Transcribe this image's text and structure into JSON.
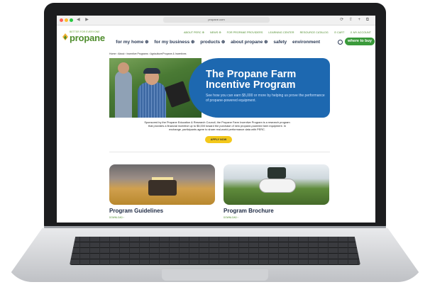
{
  "browser": {
    "url": "propane.com",
    "nav_glyphs": "◀ ▶",
    "right_glyphs": "⟳ ⇧ + ⧉",
    "dot_colors": [
      "#ff5f57",
      "#febc2e",
      "#28c840"
    ]
  },
  "site": {
    "logo_tagline": "BETTER FOR EVERYONE",
    "logo_name": "propane",
    "utility_links": [
      "ABOUT PERC ⊕",
      "NEWS ⊕",
      "FOR PROPANE PROVIDERS",
      "LEARNING CENTER",
      "RESOURCE CATALOG",
      "⊙ CART",
      "♙ MY ACCOUNT"
    ],
    "main_nav": [
      "for my home ⊕",
      "for my business ⊕",
      "products ⊕",
      "about propane ⊕",
      "safety",
      "environment"
    ],
    "buy_button": "where to buy",
    "breadcrumb": "Home › About › Incentive Programs › Agriculture/Propane & Incentives"
  },
  "hero": {
    "title": "The Propane Farm Incentive Program",
    "subtitle": "See how you can earn $5,000 or more by helping us prove the performance of propane-powered equipment."
  },
  "intro": {
    "sponsor_text": "Sponsored by the Propane Education & Research Council, the Propane Farm Incentive Program is a research program that provides a financial incentive up to $5,000 toward the purchase of new propane-powered farm equipment. In exchange, participants agree to share real-world performance data with PERC.",
    "apply_label": "APPLY NOW"
  },
  "cards": [
    {
      "title": "Program Guidelines",
      "link": "DOWNLOAD ›"
    },
    {
      "title": "Program Brochure",
      "link": "DOWNLOAD ›"
    }
  ],
  "colors": {
    "brand_green": "#4f8d2d",
    "hero_blue": "#1d68b0",
    "apply_yellow": "#f3c81b"
  }
}
